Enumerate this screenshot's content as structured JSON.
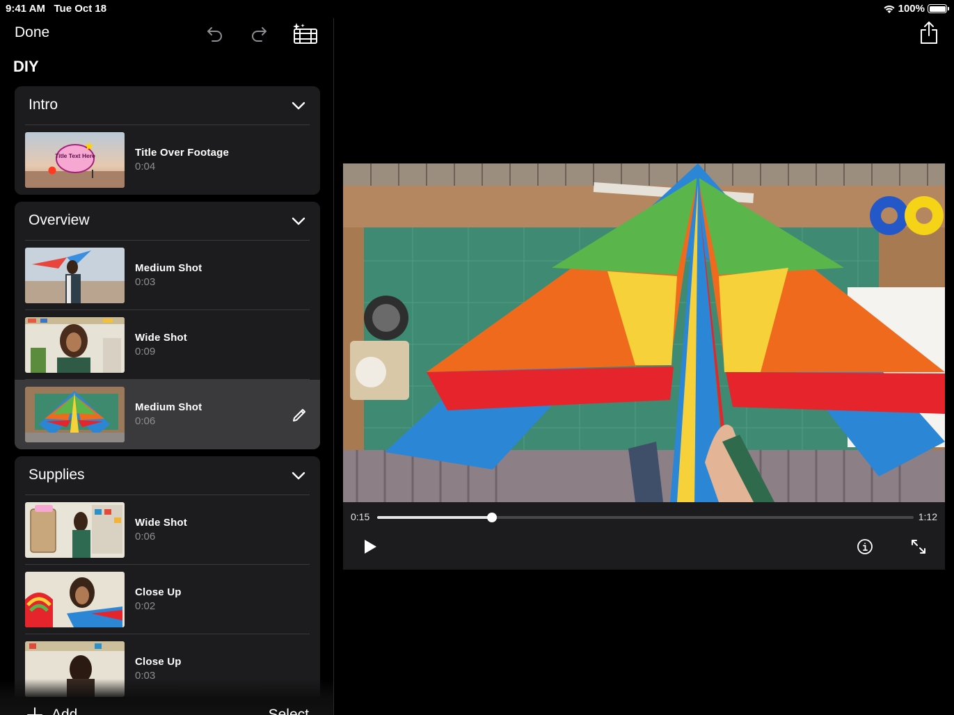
{
  "status": {
    "time": "9:41 AM",
    "date": "Tue Oct 18",
    "battery": "100%",
    "battery_level": 1.0
  },
  "toolbar": {
    "done_label": "Done"
  },
  "project": {
    "title": "DIY"
  },
  "sections": [
    {
      "title": "Intro",
      "clips": [
        {
          "title": "Title Over Footage",
          "duration": "0:04",
          "thumb_text": "Title Text Here"
        }
      ]
    },
    {
      "title": "Overview",
      "clips": [
        {
          "title": "Medium Shot",
          "duration": "0:03"
        },
        {
          "title": "Wide Shot",
          "duration": "0:09"
        },
        {
          "title": "Medium Shot",
          "duration": "0:06",
          "selected": true
        }
      ]
    },
    {
      "title": "Supplies",
      "clips": [
        {
          "title": "Wide Shot",
          "duration": "0:06"
        },
        {
          "title": "Close Up",
          "duration": "0:02"
        },
        {
          "title": "Close Up",
          "duration": "0:03"
        }
      ]
    }
  ],
  "bottom": {
    "add_label": "Add",
    "select_label": "Select"
  },
  "player": {
    "current_time": "0:15",
    "total_time": "1:12",
    "progress": 0.214
  },
  "colors": {
    "background": "#000000",
    "panel": "#1c1c1e",
    "selected_row": "#3a3a3c",
    "secondary_text": "#8e8e93"
  }
}
